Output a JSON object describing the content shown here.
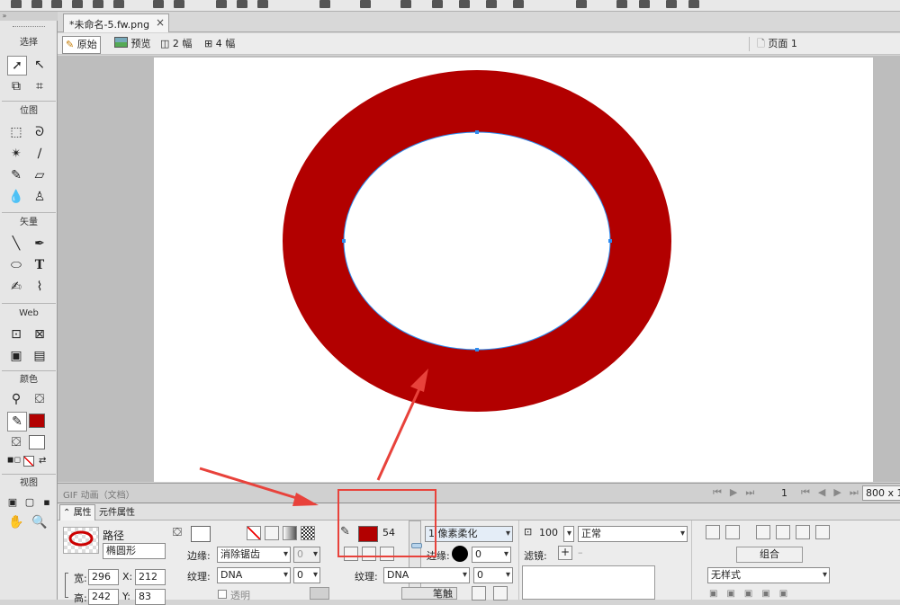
{
  "document": {
    "tab_title": "*未命名-5.fw.png",
    "page_label": "页面 1"
  },
  "view_modes": {
    "original": "原始",
    "preview": "预览",
    "two_up": "2 幅",
    "four_up": "4 幅"
  },
  "tools": {
    "sections": {
      "select": "选择",
      "bitmap": "位图",
      "vector": "矢量",
      "web": "Web",
      "colors": "颜色",
      "view": "视图"
    },
    "colors": {
      "stroke": "#b20000",
      "fill": "#ffffff"
    }
  },
  "canvas": {
    "background": "#ffffff",
    "ring_color": "#b20000",
    "path_color": "#2d8cf0"
  },
  "frame_bar": {
    "label": "GIF 动画（文档）",
    "frame_number": "1",
    "size": "800 x 1"
  },
  "panel_tabs": {
    "properties": "属性",
    "symbol_properties": "元件属性"
  },
  "object": {
    "type": "路径",
    "name": "椭圆形",
    "width_label": "宽:",
    "width": "296",
    "height_label": "高:",
    "height": "242",
    "x_label": "X:",
    "x": "212",
    "y_label": "Y:",
    "y": "83"
  },
  "fill": {
    "edge_label": "边缘:",
    "edge_value": "消除锯齿",
    "edge_amount": "0",
    "texture_label": "纹理:",
    "texture_value": "DNA",
    "texture_amount": "0",
    "transparent_label": "透明"
  },
  "stroke": {
    "size": "54",
    "style": "1 像素柔化",
    "edge_label": "边缘:",
    "edge_amount": "0",
    "texture_label": "纹理:",
    "texture_value": "DNA",
    "texture_amount": "0",
    "button_label": "笔触"
  },
  "effects": {
    "opacity": "100",
    "blend_mode": "正常",
    "filters_label": "滤镜:"
  },
  "style_panel": {
    "group_label": "组合",
    "style_value": "无样式"
  }
}
